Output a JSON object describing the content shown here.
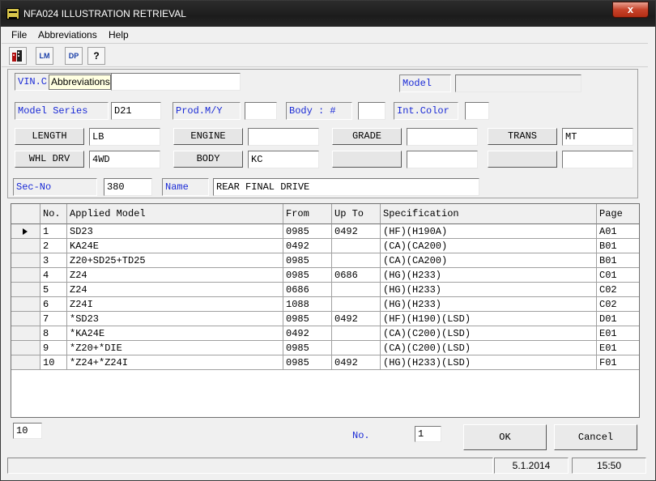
{
  "window": {
    "title": "NFA024 ILLUSTRATION RETRIEVAL",
    "close_label": "x"
  },
  "menu": {
    "items": [
      "File",
      "Abbreviations",
      "Help"
    ]
  },
  "toolbar": {
    "buttons": [
      {
        "icon": "building-icon",
        "label": ""
      },
      {
        "icon": "lm-icon",
        "label": "LM"
      },
      {
        "icon": "dp-icon",
        "label": "DP"
      },
      {
        "icon": "help-icon",
        "label": "?"
      }
    ]
  },
  "tooltip": "Abbreviations",
  "form": {
    "vin_label": "VIN.C",
    "vin_value": "",
    "model_label": "Model",
    "model_value": "",
    "model_series_label": "Model Series",
    "model_series_value": "D21",
    "prod_label": "Prod.M/Y",
    "prod_value": "",
    "body_no_label": "Body : #",
    "body_no_value": "",
    "int_color_label": "Int.Color",
    "int_color_value": "",
    "length_label": "LENGTH",
    "length_value": "LB",
    "engine_label": "ENGINE",
    "engine_value": "",
    "grade_label": "GRADE",
    "grade_value": "",
    "trans_label": "TRANS",
    "trans_value": "MT",
    "whl_drv_label": "WHL DRV",
    "whl_drv_value": "4WD",
    "body_label": "BODY",
    "body_value": "KC",
    "blank1_label": "",
    "blank1_value": "",
    "blank2_label": "",
    "blank2_value": "",
    "sec_no_label": "Sec-No",
    "sec_no_value": "380",
    "name_label": "Name",
    "name_value": "REAR FINAL DRIVE"
  },
  "table": {
    "headers": [
      "No.",
      "Applied Model",
      "From",
      "Up To",
      "Specification",
      "Page"
    ],
    "rows": [
      [
        "1",
        "SD23",
        "0985",
        "0492",
        "(HF)(H190A)",
        "A01"
      ],
      [
        "2",
        "KA24E",
        "0492",
        "",
        "(CA)(CA200)",
        "B01"
      ],
      [
        "3",
        "Z20+SD25+TD25",
        "0985",
        "",
        "(CA)(CA200)",
        "B01"
      ],
      [
        "4",
        "Z24",
        "0985",
        "0686",
        "(HG)(H233)",
        "C01"
      ],
      [
        "5",
        "Z24",
        "0686",
        "",
        "(HG)(H233)",
        "C02"
      ],
      [
        "6",
        "Z24I",
        "1088",
        "",
        "(HG)(H233)",
        "C02"
      ],
      [
        "7",
        "*SD23",
        "0985",
        "0492",
        "(HF)(H190)(LSD)",
        "D01"
      ],
      [
        "8",
        "*KA24E",
        "0492",
        "",
        "(CA)(C200)(LSD)",
        "E01"
      ],
      [
        "9",
        "*Z20+*DIE",
        "0985",
        "",
        "(CA)(C200)(LSD)",
        "E01"
      ],
      [
        "10",
        "*Z24+*Z24I",
        "0985",
        "0492",
        "(HG)(H233)(LSD)",
        "F01"
      ]
    ],
    "selected_row": 0
  },
  "footer": {
    "count_value": "10",
    "no_label": "No.",
    "no_value": "1",
    "ok_label": "OK",
    "cancel_label": "Cancel"
  },
  "status": {
    "blank": "",
    "date": "5.1.2014",
    "time": "15:50"
  }
}
